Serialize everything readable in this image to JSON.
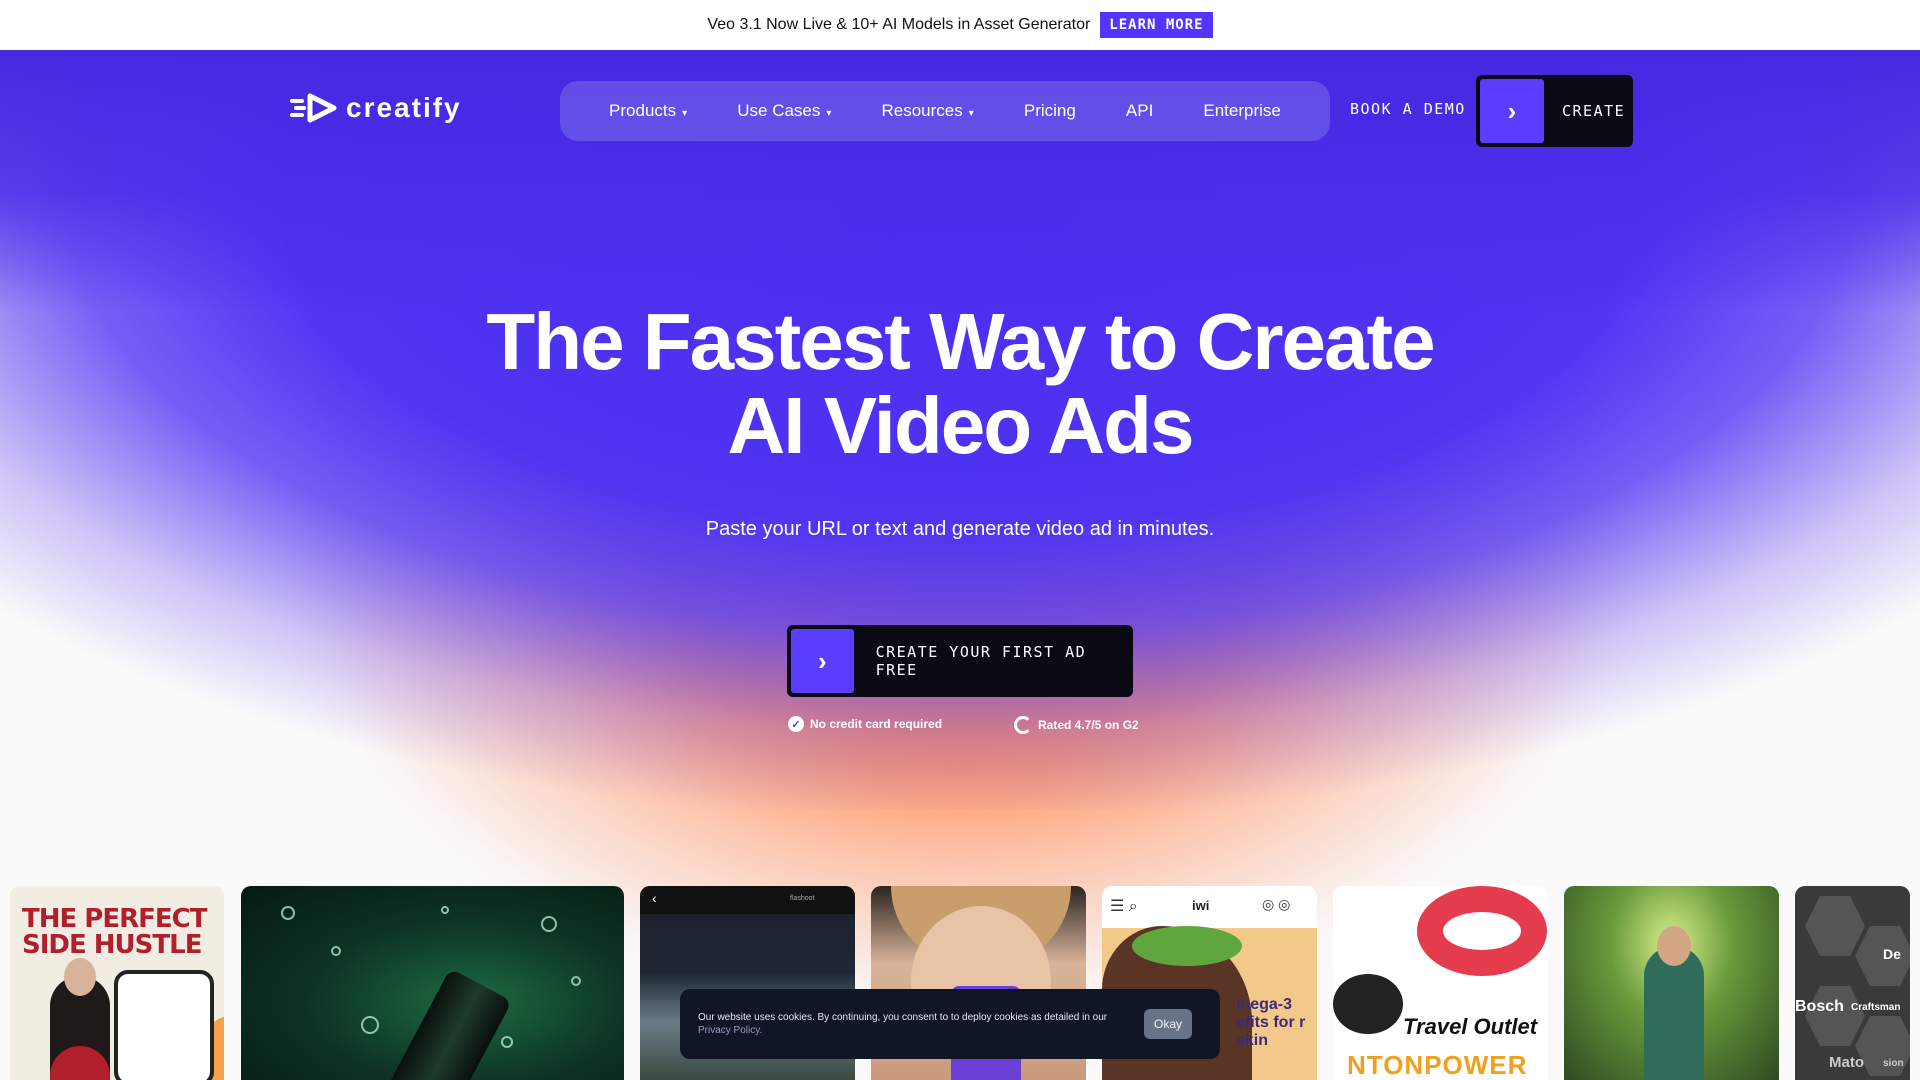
{
  "announcement": {
    "text": "Veo 3.1 Now Live & 10+ AI Models in Asset Generator",
    "button": "LEARN MORE"
  },
  "brand": {
    "name": "creatify"
  },
  "nav": {
    "items": [
      {
        "label": "Products",
        "dropdown": true
      },
      {
        "label": "Use Cases",
        "dropdown": true
      },
      {
        "label": "Resources",
        "dropdown": true
      },
      {
        "label": "Pricing",
        "dropdown": false
      },
      {
        "label": "API",
        "dropdown": false
      },
      {
        "label": "Enterprise",
        "dropdown": false
      }
    ],
    "book_demo": "BOOK A DEMO",
    "create": "CREATE"
  },
  "hero": {
    "title_line1": "The Fastest Way to Create",
    "title_line2": "AI Video Ads",
    "subtitle": "Paste your URL or text and generate video ad in minutes.",
    "cta": "CREATE YOUR FIRST AD FREE",
    "trust_1": "No credit card required",
    "trust_2": "Rated 4.7/5 on G2"
  },
  "cards": {
    "c1_title": "THE PERFECT SIDE HUSTLE",
    "c3_label": "flashoot",
    "c5_brand": "iwi",
    "c5_text": "mega-3 efits for r skin",
    "c6_title": "Travel Outlet",
    "c6_brand": "NTONPOWER",
    "c8_labels": [
      "De",
      "Bosch",
      "Craftsman",
      "Mato",
      "sion"
    ]
  },
  "cookie": {
    "message": "Our website uses cookies. By continuing, you consent to to deploy cookies as detailed in our ",
    "link": "Privacy Policy.",
    "button": "Okay"
  },
  "colors": {
    "accent": "#5236ff",
    "hero_blue": "#4b2cf0",
    "hero_orange": "#ff7a3c",
    "button_dark": "#0b0a14"
  }
}
